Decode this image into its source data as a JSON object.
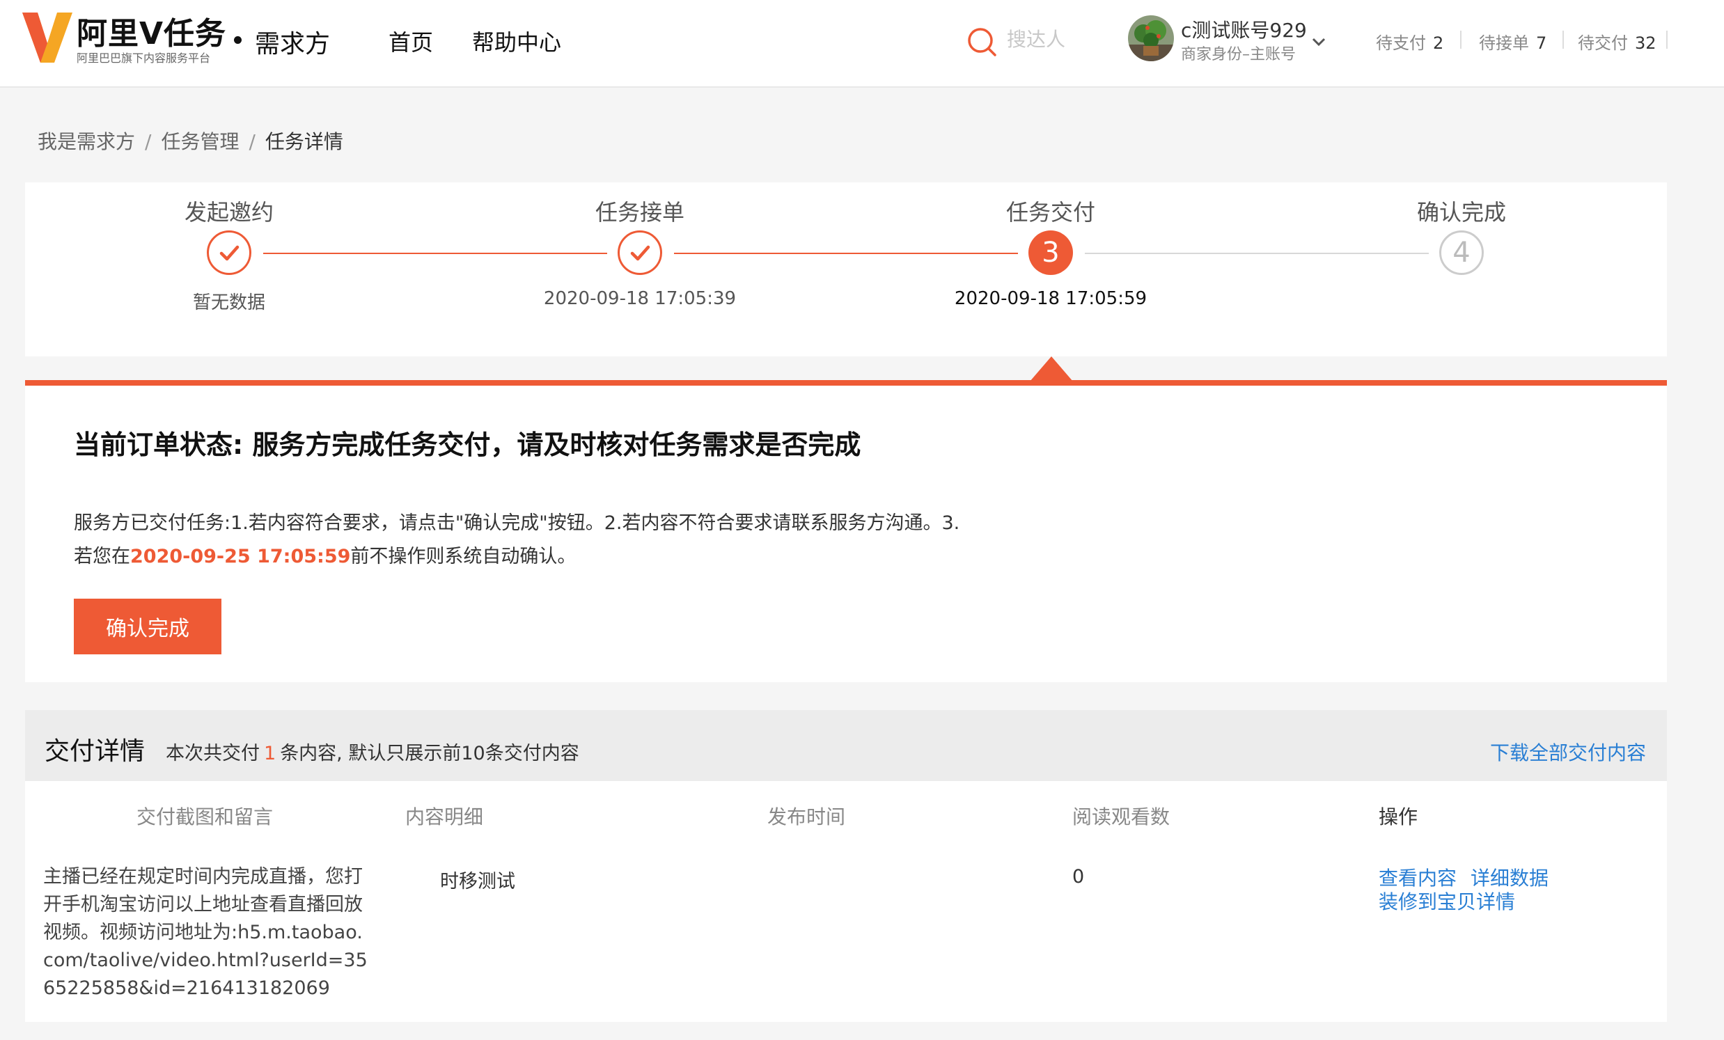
{
  "header": {
    "logo_title": "阿里V任务",
    "logo_subtitle": "阿里巴巴旗下内容服务平台",
    "role": "需求方",
    "nav": [
      "首页",
      "帮助中心"
    ],
    "search_placeholder": "搜达人",
    "account_name": "c测试账号929",
    "account_role": "商家身份–主账号",
    "stats": [
      {
        "label": "待支付",
        "count": "2"
      },
      {
        "label": "待接单",
        "count": "7"
      },
      {
        "label": "待交付",
        "count": "32"
      }
    ],
    "brand_color": "#ee5a35"
  },
  "breadcrumb": [
    "我是需求方",
    "任务管理",
    "任务详情"
  ],
  "steps": [
    {
      "label": "发起邀约",
      "state": "done",
      "time": "暂无数据"
    },
    {
      "label": "任务接单",
      "state": "done",
      "time": "2020-09-18 17:05:39"
    },
    {
      "label": "任务交付",
      "state": "active",
      "number": "3",
      "time": "2020-09-18 17:05:59"
    },
    {
      "label": "确认完成",
      "state": "todo",
      "number": "4",
      "time": ""
    }
  ],
  "status": {
    "title": "当前订单状态: 服务方完成任务交付，请及时核对任务需求是否完成",
    "desc_line1": "服务方已交付任务:1.若内容符合要求，请点击\"确认完成\"按钮。2.若内容不符合要求请联系服务方沟通。3.",
    "desc_line2_pre": "若您在",
    "deadline": "2020-09-25 17:05:59",
    "desc_line2_post": "前不操作则系统自动确认。",
    "confirm_label": "确认完成"
  },
  "delivery": {
    "title": "交付详情",
    "summary_pre": "本次共交付",
    "count": "1",
    "summary_post": "条内容, 默认只展示前10条交付内容",
    "download_label": "下载全部交付内容",
    "columns": [
      "交付截图和留言",
      "内容明细",
      "发布时间",
      "阅读观看数",
      "操作"
    ],
    "rows": [
      {
        "message": "主播已经在规定时间内完成直播，您打开手机淘宝访问以上地址查看直播回放视频。视频访问地址为:h5.m.taobao.com/taolive/video.html?userId=3565225858&id=216413182069",
        "content": "时移测试",
        "publish_time": "",
        "views": "0",
        "actions": [
          "查看内容",
          "详细数据",
          "装修到宝贝详情"
        ]
      }
    ]
  }
}
